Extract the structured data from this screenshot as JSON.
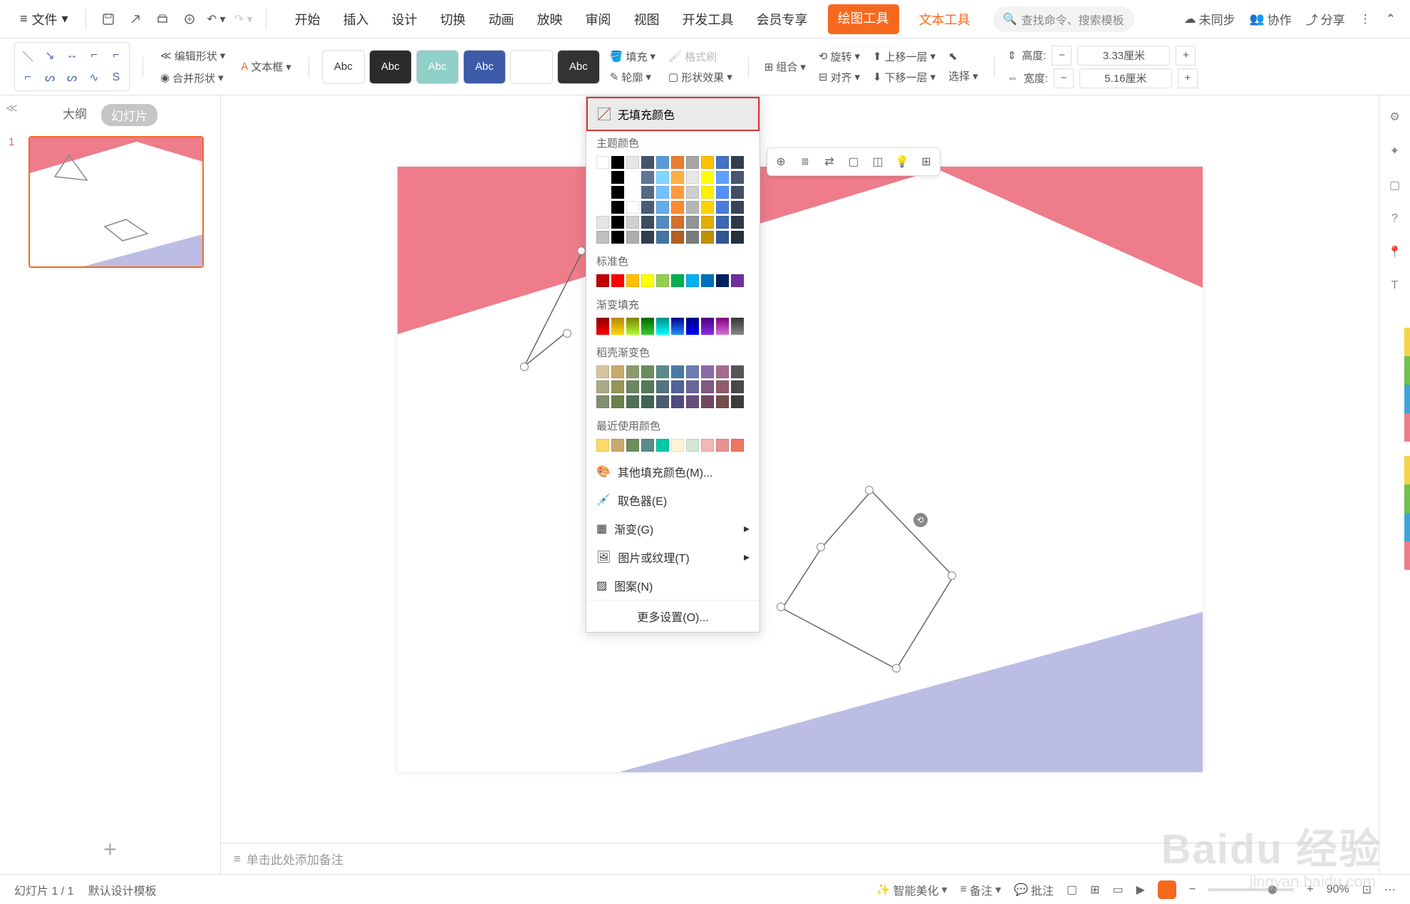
{
  "menu": {
    "file": "文件",
    "tabs": [
      "开始",
      "插入",
      "设计",
      "切换",
      "动画",
      "放映",
      "审阅",
      "视图",
      "开发工具",
      "会员专享"
    ],
    "drawing_tools": "绘图工具",
    "text_tools": "文本工具",
    "search_placeholder": "查找命令、搜索模板",
    "unsynced": "未同步",
    "cooperate": "协作",
    "share": "分享"
  },
  "ribbon": {
    "edit_shape": "编辑形状",
    "textbox": "文本框",
    "merge_shape": "合并形状",
    "style_label": "Abc",
    "fill": "填充",
    "outline": "轮廓",
    "shape_effect": "形状效果",
    "format_painter": "格式刷",
    "combine": "组合",
    "rotate": "旋转",
    "align": "对齐",
    "up_one": "上移一层",
    "down_one": "下移一层",
    "select": "选择",
    "height_label": "高度:",
    "height_value": "3.33厘米",
    "width_label": "宽度:",
    "width_value": "5.16厘米"
  },
  "sidebar": {
    "outline_tab": "大纲",
    "slides_tab": "幻灯片",
    "slide_num": "1"
  },
  "fill_panel": {
    "no_fill": "无填充颜色",
    "theme_colors": "主题颜色",
    "standard_colors": "标准色",
    "gradient_fill": "渐变填充",
    "docer_gradient": "稻壳渐变色",
    "recent_colors": "最近使用颜色",
    "more_colors": "其他填充颜色(M)...",
    "eyedropper": "取色器(E)",
    "gradient": "渐变(G)",
    "picture_texture": "图片或纹理(T)",
    "pattern": "图案(N)",
    "more_settings": "更多设置(O)...",
    "theme_main": [
      "#ffffff",
      "#000000",
      "#e7e6e6",
      "#44546a",
      "#5b9bd5",
      "#ed7d31",
      "#a5a5a5",
      "#ffc000",
      "#4472c4",
      "#333f50"
    ],
    "standard": [
      "#c00000",
      "#ff0000",
      "#ffc000",
      "#ffff00",
      "#92d050",
      "#00b050",
      "#00b0f0",
      "#0070c0",
      "#002060",
      "#7030a0"
    ],
    "gradients": [
      "linear-gradient(#8b0000,#ff0000)",
      "linear-gradient(#b8860b,#ffd700)",
      "linear-gradient(#808000,#adff2f)",
      "linear-gradient(#006400,#32cd32)",
      "linear-gradient(#008b8b,#00ffff)",
      "linear-gradient(#00008b,#1e90ff)",
      "linear-gradient(#000080,#0000ff)",
      "linear-gradient(#4b0082,#8a2be2)",
      "linear-gradient(#800080,#da70d6)",
      "linear-gradient(#333,#888)"
    ],
    "docer": [
      "#d4c5a0",
      "#c9a86e",
      "#8b9b6e",
      "#6b8e5a",
      "#5a8b8b",
      "#4a7ba6",
      "#6b7db3",
      "#8b6ba6",
      "#a66b8e",
      "#555"
    ],
    "recent": [
      "#ffd966",
      "#c9a86e",
      "#6b8e5a",
      "#5a8b8b",
      "#00c9a7",
      "#fff5d4",
      "#d4e8d4",
      "#f5b5b5",
      "#e89090",
      "#f07560"
    ]
  },
  "notes": {
    "placeholder": "单击此处添加备注"
  },
  "status": {
    "slide_counter": "幻灯片 1 / 1",
    "template": "默认设计模板",
    "smart_beautify": "智能美化",
    "notes": "备注",
    "comments": "批注",
    "zoom": "90%"
  },
  "watermark": "Baidu 经验",
  "watermark_sub": "jingyan.baidu.com"
}
